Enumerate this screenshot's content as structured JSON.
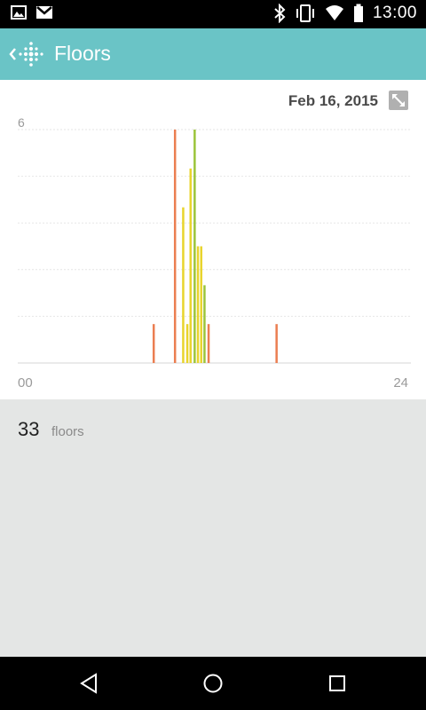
{
  "status_bar": {
    "time": "13:00",
    "left_icons": [
      "image-icon",
      "gmail-icon"
    ],
    "right_icons": [
      "bluetooth-icon",
      "vibrate-icon",
      "wifi-icon",
      "battery-icon"
    ]
  },
  "app_bar": {
    "title": "Floors",
    "back_icon": "chevron-left-icon",
    "logo_icon": "fitbit-logo-icon",
    "background_color": "#6ac4c6"
  },
  "chart_card": {
    "date": "Feb 16, 2015",
    "expand_icon": "expand-icon"
  },
  "chart_data": {
    "type": "bar",
    "xlabel": "",
    "ylabel": "",
    "x_tick_labels": [
      "00",
      "24"
    ],
    "y_tick_labels": [
      "6"
    ],
    "xlim": [
      0,
      24
    ],
    "ylim": [
      0,
      6
    ],
    "grid": true,
    "colors": {
      "low": "#eb7e51",
      "mid": "#e8d42c",
      "high": "#9bc43a"
    },
    "bars": [
      {
        "x": 8.3,
        "y": 1,
        "color": "#eb7e51"
      },
      {
        "x": 9.6,
        "y": 6,
        "color": "#eb7e51"
      },
      {
        "x": 10.1,
        "y": 4,
        "color": "#e8d42c"
      },
      {
        "x": 10.35,
        "y": 1,
        "color": "#e8d42c"
      },
      {
        "x": 10.55,
        "y": 5,
        "color": "#e8d42c"
      },
      {
        "x": 10.8,
        "y": 6,
        "color": "#9bc43a"
      },
      {
        "x": 11.0,
        "y": 3,
        "color": "#e8d42c"
      },
      {
        "x": 11.2,
        "y": 3,
        "color": "#e8d42c"
      },
      {
        "x": 11.4,
        "y": 2,
        "color": "#9bc43a"
      },
      {
        "x": 11.65,
        "y": 1,
        "color": "#eb7e51"
      },
      {
        "x": 15.8,
        "y": 1,
        "color": "#eb7e51"
      }
    ]
  },
  "summary": {
    "value": "33",
    "unit": "floors"
  },
  "nav_bar": {
    "buttons": [
      "back-nav-icon",
      "home-nav-icon",
      "recents-nav-icon"
    ]
  }
}
